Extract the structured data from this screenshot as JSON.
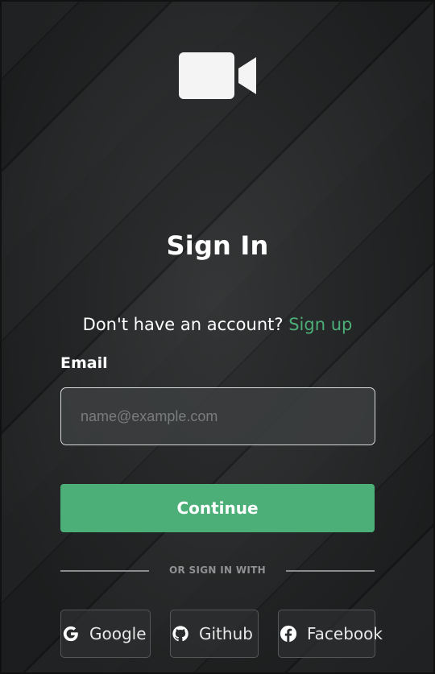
{
  "logo": {
    "icon": "video-camera-icon"
  },
  "title": "Sign In",
  "account_prompt": {
    "text": "Don't have an account?",
    "link_label": "Sign up"
  },
  "email": {
    "label": "Email",
    "placeholder": "name@example.com",
    "value": ""
  },
  "continue_label": "Continue",
  "divider_text": "OR SIGN IN WITH",
  "social": {
    "google": {
      "label": "Google",
      "icon": "google-icon"
    },
    "github": {
      "label": "Github",
      "icon": "github-icon"
    },
    "facebook": {
      "label": "Facebook",
      "icon": "facebook-icon"
    }
  },
  "colors": {
    "accent": "#4caf78",
    "background": "#232526",
    "text": "#ffffff"
  }
}
